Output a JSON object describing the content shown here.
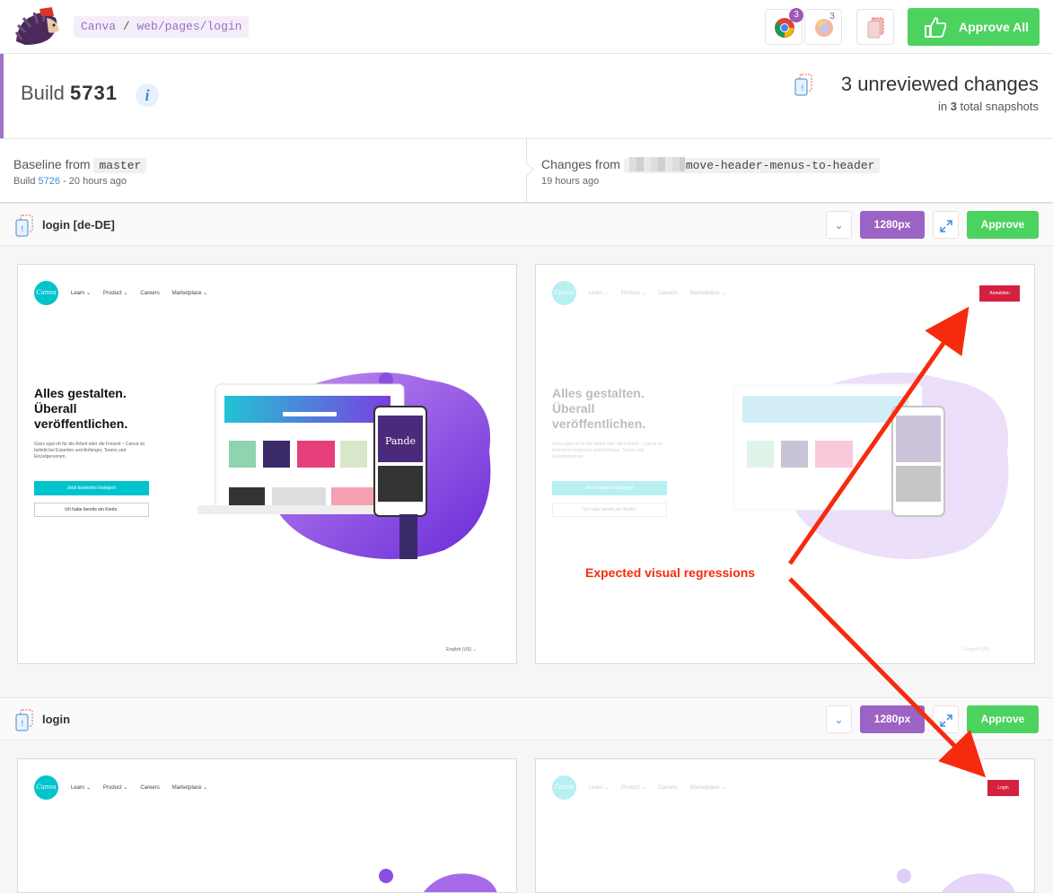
{
  "topbar": {
    "breadcrumb": [
      "Canva",
      "/",
      "web/pages/login"
    ],
    "browsers": [
      {
        "icon": "chrome-icon",
        "count": "3"
      },
      {
        "icon": "firefox-icon",
        "count": "3"
      }
    ],
    "approve_all_label": "Approve All"
  },
  "build": {
    "label": "Build",
    "number": "5731",
    "info": "i",
    "unreviewed_count": "3",
    "unreviewed_label": "unreviewed changes",
    "snapshots_prefix": "in",
    "snapshots_count": "3",
    "snapshots_suffix": "total snapshots"
  },
  "baseline": {
    "label": "Baseline from",
    "branch": "master",
    "build_prefix": "Build",
    "build_number": "5726",
    "time": "- 20 hours ago"
  },
  "changes": {
    "label": "Changes from",
    "branch": "move-header-menus-to-header",
    "time": "19 hours ago"
  },
  "snapshots": [
    {
      "title": "login [de-DE]",
      "resolution": "1280px",
      "approve_label": "Approve",
      "page": {
        "logo": "Canva",
        "nav": [
          "Learn ⌄",
          "Product ⌄",
          "Careers",
          "Marketplace ⌄"
        ],
        "hero_title": "Alles gestalten. Überall veröffentlichen.",
        "hero_text": "Ganz egal ob für die Arbeit oder die Freizeit – Canva ist beliebt bei Experten und Anfänger, Teams und Einzelpersonen.",
        "cta_primary": "Jetzt kostenlos loslegen!",
        "cta_secondary": "Ich habe bereits ein Konto.",
        "language": "English (US) ⌄",
        "header_login": "Anmelden"
      }
    },
    {
      "title": "login",
      "resolution": "1280px",
      "approve_label": "Approve",
      "page": {
        "logo": "Canva",
        "nav": [
          "Learn ⌄",
          "Product ⌄",
          "Careers",
          "Marketplace ⌄"
        ],
        "header_login": "Login"
      }
    }
  ],
  "annotation": "Expected visual regressions",
  "colors": {
    "accent": "#9b63c4",
    "approve": "#4cd25f",
    "link": "#3f8bd8",
    "annotation": "#f62b0d"
  }
}
